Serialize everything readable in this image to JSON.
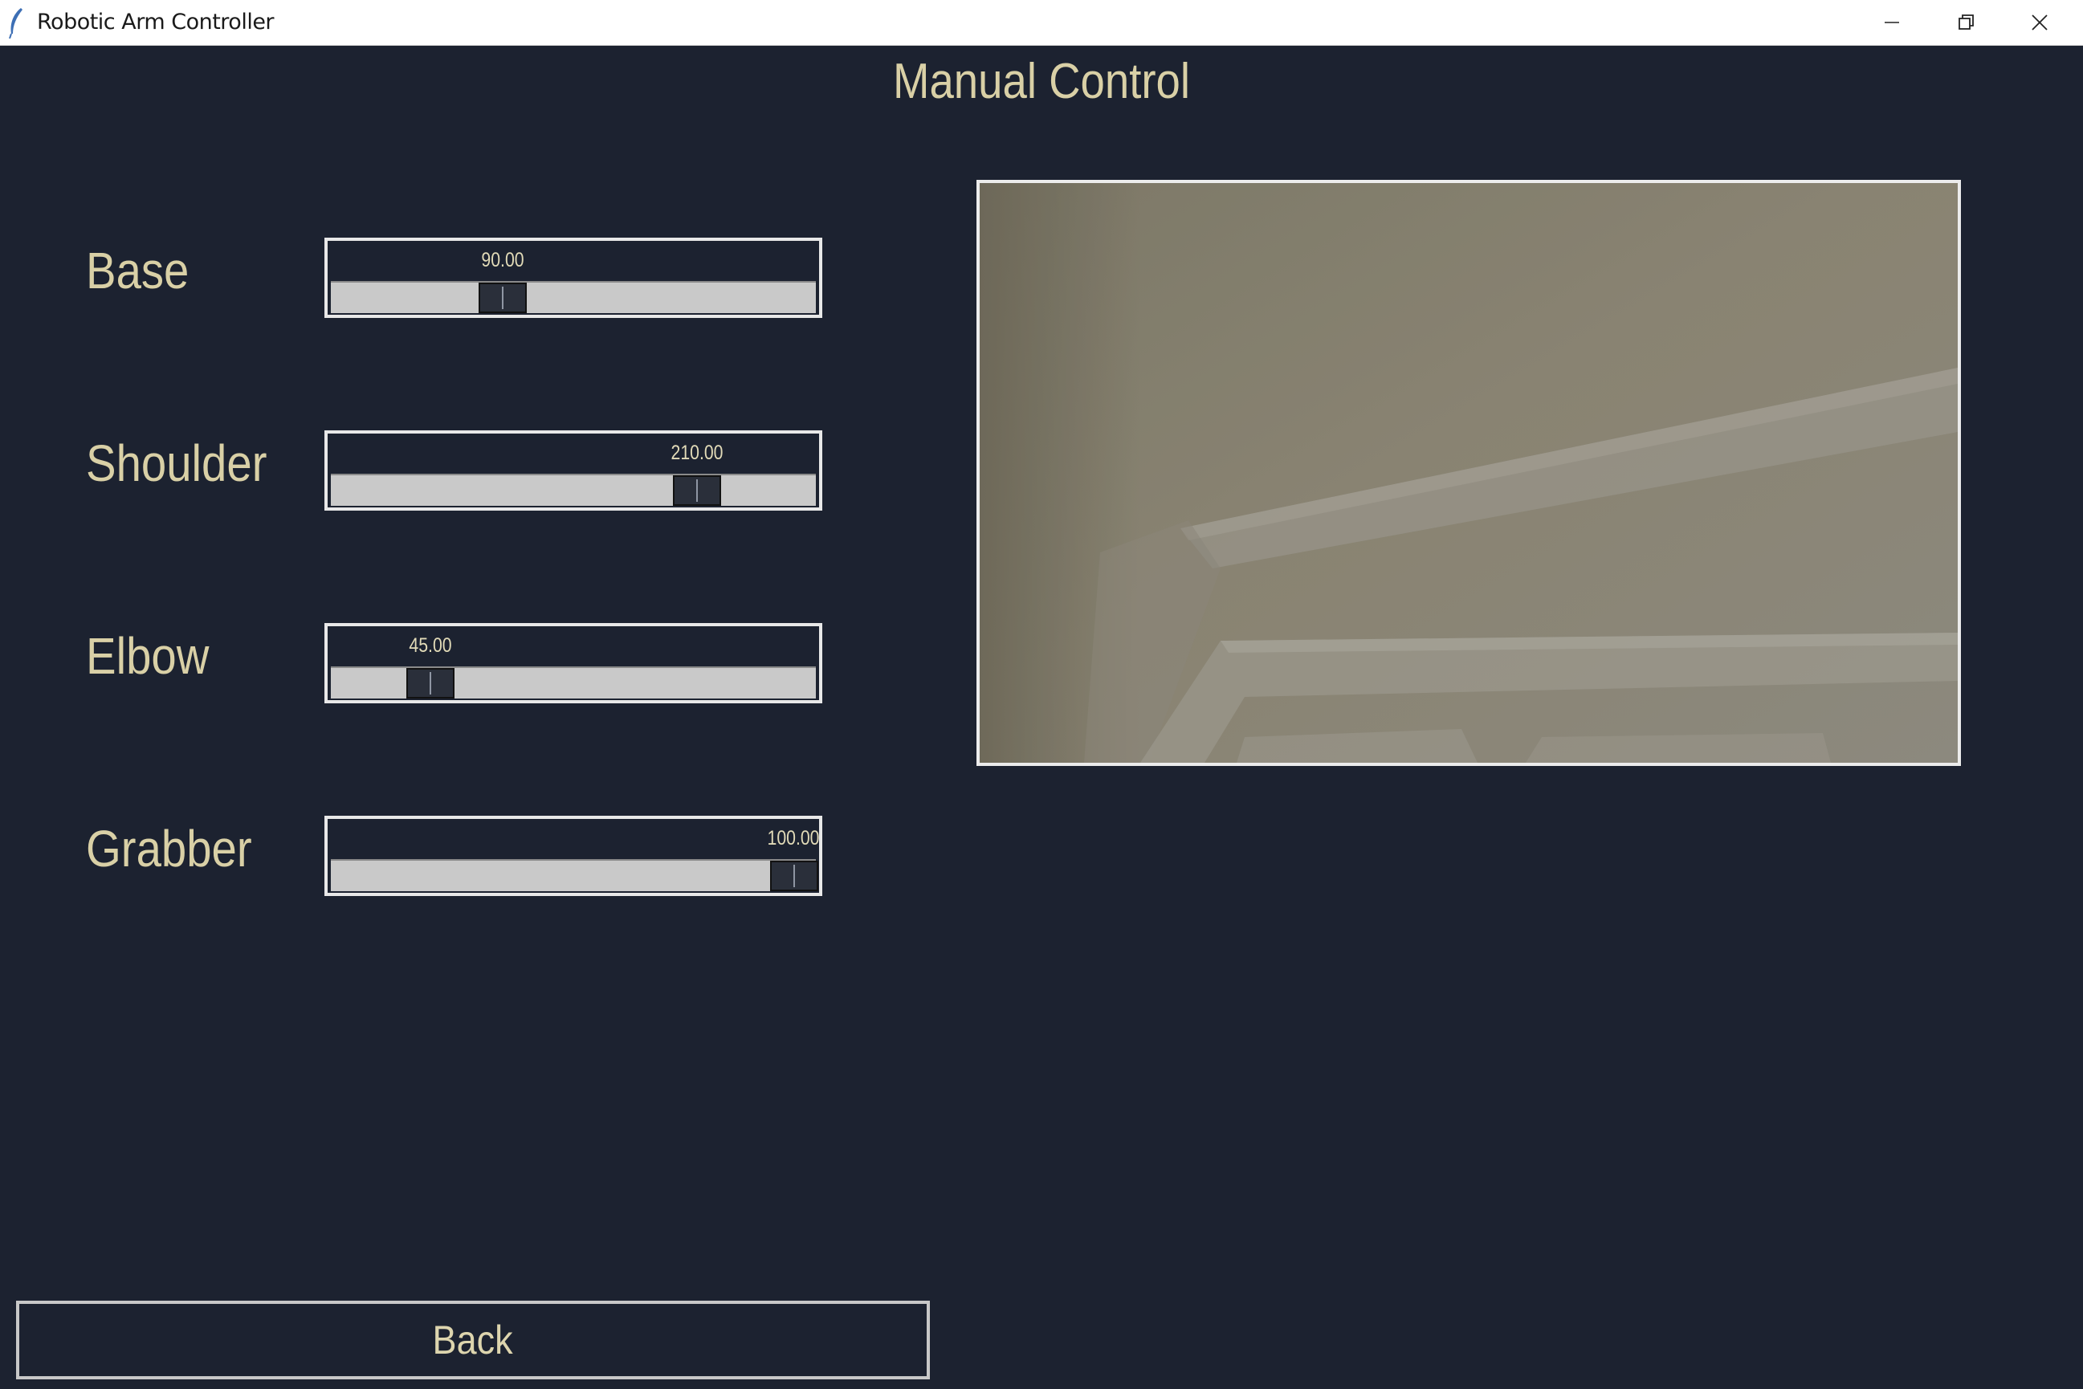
{
  "window": {
    "title": "Robotic Arm Controller",
    "app_icon": "feather-icon",
    "controls": [
      "minimize-icon",
      "restore-icon",
      "close-icon"
    ]
  },
  "page": {
    "title": "Manual Control"
  },
  "sliders": [
    {
      "label": "Base",
      "value": 90,
      "value_text": "90.00",
      "position_fraction": 0.355
    },
    {
      "label": "Shoulder",
      "value": 210,
      "value_text": "210.00",
      "position_fraction": 0.755
    },
    {
      "label": "Elbow",
      "value": 45,
      "value_text": "45.00",
      "position_fraction": 0.205
    },
    {
      "label": "Grabber",
      "value": 100,
      "value_text": "100.00",
      "position_fraction": 0.955
    }
  ],
  "camera": {
    "icon": "camera-feed"
  },
  "footer": {
    "back_label": "Back"
  },
  "colors": {
    "background": "#1c2230",
    "label_text": "#d9d0a6",
    "trough": "#c9c9c9",
    "border": "#e8e8e8"
  }
}
